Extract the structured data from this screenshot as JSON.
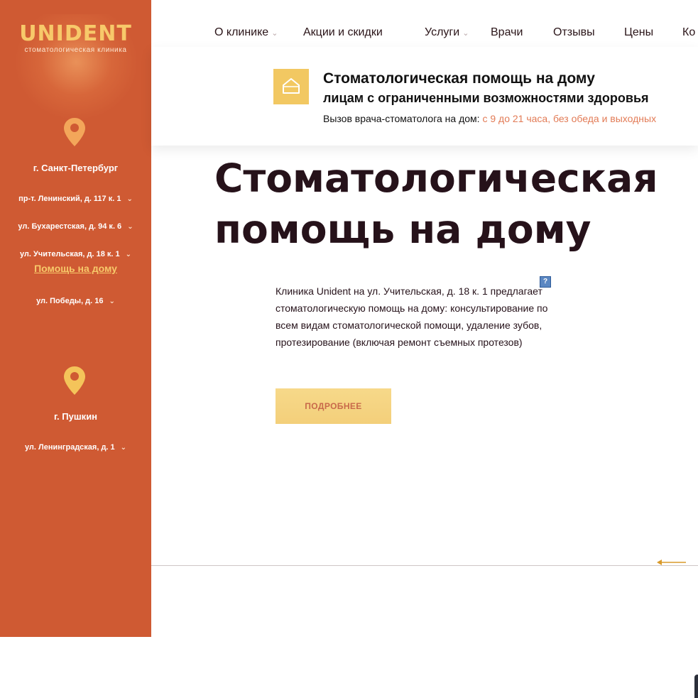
{
  "sidebar": {
    "logo": "UNIDENT",
    "logo_sub": "стоматологическая клиника",
    "cities": [
      {
        "name": "г. Санкт-Петербург",
        "addresses": [
          "пр-т. Ленинский, д. 117 к. 1",
          "ул. Бухарестская, д. 94 к. 6",
          "ул. Учительская, д. 18 к. 1"
        ],
        "link": "Помощь на дому",
        "after_link_address": "ул. Победы, д. 16"
      },
      {
        "name": "г. Пушкин",
        "addresses": [
          "ул. Ленинградская, д. 1"
        ]
      }
    ]
  },
  "nav": {
    "items": [
      "О клинике",
      "Акции и скидки",
      "Услуги",
      "Врачи",
      "Отзывы",
      "Цены",
      "Ко"
    ]
  },
  "banner": {
    "title": "Стоматологическая помощь на дому",
    "subtitle": "лицам с ограниченными возможностями здоровья",
    "line_prefix": "Вызов врача-стоматолога на дом: ",
    "line_accent": "с 9 до 21 часа, без обеда и выходных"
  },
  "main": {
    "title": "Стоматологическая помощь на дому",
    "help_icon": "?",
    "description": "Клиника Unident на ул. Учительская, д. 18 к. 1 предлагает стоматологическую помощь на дому: консультирование по всем видам стоматологической помощи, удаление зубов, протезирование (включая ремонт съемных протезов)",
    "button": "ПОДРОБНЕЕ"
  },
  "colors": {
    "sidebar_bg": "#cf5a33",
    "logo": "#f7c96a",
    "accent_text": "#e27b56",
    "button_bg": "#f5d582",
    "title_text": "#26121a"
  },
  "icons": [
    "map-pin-icon",
    "house-icon",
    "chevron-down-icon",
    "help-icon",
    "arrow-left-icon"
  ]
}
